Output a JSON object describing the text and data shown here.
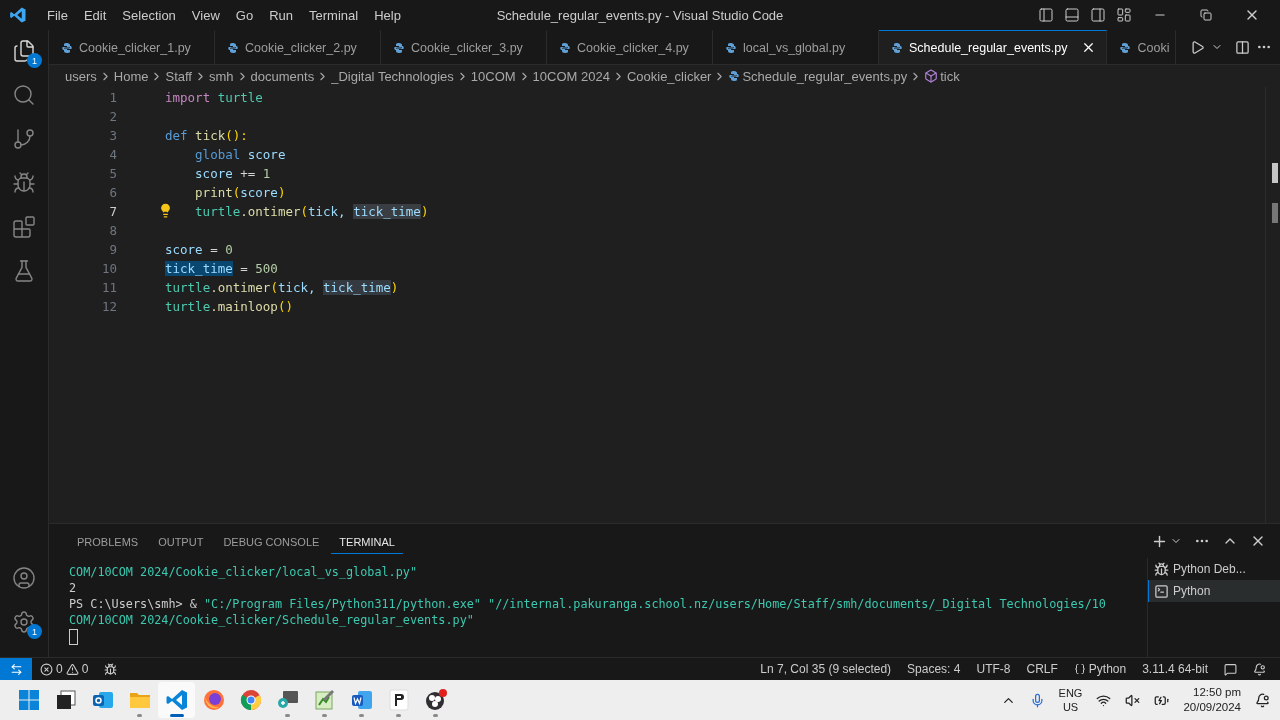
{
  "window": {
    "title": "Schedule_regular_events.py - Visual Studio Code"
  },
  "menu": [
    "File",
    "Edit",
    "Selection",
    "View",
    "Go",
    "Run",
    "Terminal",
    "Help"
  ],
  "activity_bar": [
    {
      "kind": "explorer",
      "badge": "1"
    },
    {
      "kind": "search"
    },
    {
      "kind": "source-control"
    },
    {
      "kind": "debug"
    },
    {
      "kind": "extensions"
    },
    {
      "kind": "testing"
    }
  ],
  "activity_bar_bottom": [
    {
      "kind": "account"
    },
    {
      "kind": "settings",
      "badge": "1"
    }
  ],
  "tabs": [
    {
      "label": "Cookie_clicker_1.py",
      "selected": false
    },
    {
      "label": "Cookie_clicker_2.py",
      "selected": false
    },
    {
      "label": "Cookie_clicker_3.py",
      "selected": false
    },
    {
      "label": "Cookie_clicker_4.py",
      "selected": false
    },
    {
      "label": "local_vs_global.py",
      "selected": false
    },
    {
      "label": "Schedule_regular_events.py",
      "selected": true
    },
    {
      "label": "Cooki",
      "selected": false
    }
  ],
  "breadcrumbs": [
    {
      "label": "users",
      "kind": "folder"
    },
    {
      "label": "Home",
      "kind": "folder"
    },
    {
      "label": "Staff",
      "kind": "folder"
    },
    {
      "label": "smh",
      "kind": "folder"
    },
    {
      "label": "documents",
      "kind": "folder"
    },
    {
      "label": "_Digital Technologies",
      "kind": "folder"
    },
    {
      "label": "10COM",
      "kind": "folder"
    },
    {
      "label": "10COM 2024",
      "kind": "folder"
    },
    {
      "label": "Cookie_clicker",
      "kind": "folder"
    },
    {
      "label": "Schedule_regular_events.py",
      "kind": "file"
    },
    {
      "label": "tick",
      "kind": "symbol"
    }
  ],
  "editor": {
    "lines": [
      {
        "number": "1",
        "current": false,
        "tokens": [
          {
            "text": "import",
            "kind": "keyword"
          },
          {
            "text": " turtle",
            "kind": "module"
          }
        ]
      },
      {
        "number": "2",
        "current": false
      },
      {
        "number": "3",
        "current": false,
        "tokens": [
          {
            "text": "def",
            "kind": "storage"
          },
          {
            "text": " tick",
            "kind": "function"
          },
          {
            "text": "():",
            "kind": "bracket"
          }
        ]
      },
      {
        "number": "4",
        "current": false,
        "indent": true,
        "tokens": [
          {
            "text": "global",
            "kind": "storage"
          },
          {
            "text": " score",
            "kind": "variable"
          }
        ]
      },
      {
        "number": "5",
        "current": false,
        "indent": true,
        "tokens": [
          {
            "text": "score",
            "kind": "variable"
          },
          {
            "text": " += ",
            "kind": "operator"
          },
          {
            "text": "1",
            "kind": "number"
          }
        ]
      },
      {
        "number": "6",
        "current": false,
        "indent": true,
        "tokens": [
          {
            "text": "print",
            "kind": "function"
          },
          {
            "text": "(",
            "kind": "bracket"
          },
          {
            "text": "score",
            "kind": "variable"
          },
          {
            "text": ")",
            "kind": "bracket"
          }
        ]
      },
      {
        "number": "7",
        "current": true,
        "indent": true,
        "lightbulb": true,
        "tokens": [
          {
            "text": "turtle",
            "kind": "module"
          },
          {
            "text": ".ontimer",
            "kind": "function"
          },
          {
            "text": "(",
            "kind": "bracket"
          },
          {
            "text": "tick, ",
            "kind": "variable"
          },
          {
            "text": "tick_time",
            "kind": "variable",
            "selected": true
          },
          {
            "text": ")",
            "kind": "bracket"
          }
        ]
      },
      {
        "number": "8",
        "current": false
      },
      {
        "number": "9",
        "current": false,
        "tokens": [
          {
            "text": "score",
            "kind": "variable"
          },
          {
            "text": " = ",
            "kind": "operator"
          },
          {
            "text": "0",
            "kind": "number"
          }
        ]
      },
      {
        "number": "10",
        "current": false,
        "tokens": [
          {
            "text": "tick_time",
            "kind": "variable",
            "highlighted": true,
            "write": true
          },
          {
            "text": " = ",
            "kind": "operator"
          },
          {
            "text": "500",
            "kind": "number"
          }
        ]
      },
      {
        "number": "11",
        "current": false,
        "tokens": [
          {
            "text": "turtle",
            "kind": "module"
          },
          {
            "text": ".ontimer",
            "kind": "function"
          },
          {
            "text": "(",
            "kind": "bracket"
          },
          {
            "text": "tick, ",
            "kind": "variable"
          },
          {
            "text": "tick_time",
            "kind": "variable",
            "highlighted": true
          },
          {
            "text": ")",
            "kind": "bracket"
          }
        ]
      },
      {
        "number": "12",
        "current": false,
        "tokens": [
          {
            "text": "turtle",
            "kind": "module"
          },
          {
            "text": ".mainloop",
            "kind": "function"
          },
          {
            "text": "()",
            "kind": "bracket"
          }
        ]
      }
    ]
  },
  "panel": {
    "tabs": [
      {
        "label": "PROBLEMS",
        "selected": false
      },
      {
        "label": "OUTPUT",
        "selected": false
      },
      {
        "label": "DEBUG CONSOLE",
        "selected": false
      },
      {
        "label": "TERMINAL",
        "selected": true
      }
    ],
    "terminal_lines": [
      [
        {
          "text": "COM/10COM 2024/Cookie_clicker/local_vs_global.py\"",
          "kind": "string"
        }
      ],
      [
        {
          "text": "2",
          "kind": "output"
        }
      ],
      [
        {
          "text": "PS C:\\Users\\smh> & ",
          "kind": "output"
        },
        {
          "text": "\"C:/Program Files/Python311/python.exe\" \"//internal.pakuranga.school.nz/users/Home/Staff/smh/documents/_Digital Technologies/10",
          "kind": "string"
        }
      ],
      [
        {
          "text": "COM/10COM 2024/Cookie_clicker/Schedule_regular_events.py\"",
          "kind": "string"
        }
      ]
    ],
    "terminals": [
      {
        "label": "Python Deb...",
        "kind": "debug",
        "selected": false
      },
      {
        "label": "Python",
        "kind": "shell",
        "selected": true
      }
    ]
  },
  "status_bar": {
    "errors": "0",
    "warnings": "0",
    "right": [
      "Ln 7, Col 35 (9 selected)",
      "Spaces: 4",
      "UTF-8",
      "CRLF",
      "Python",
      "3.11.4 64-bit"
    ]
  },
  "taskbar": {
    "apps": [
      {
        "kind": "start",
        "running": false,
        "active": false
      },
      {
        "kind": "task-view",
        "running": false,
        "active": false
      },
      {
        "kind": "mail",
        "running": false,
        "active": false
      },
      {
        "kind": "folder",
        "running": true,
        "active": false
      },
      {
        "kind": "code",
        "running": true,
        "active": true
      },
      {
        "kind": "fox",
        "running": false,
        "active": false
      },
      {
        "kind": "wheel",
        "running": false,
        "active": false
      },
      {
        "kind": "remote",
        "running": true,
        "active": false
      },
      {
        "kind": "notepad",
        "running": true,
        "active": false
      },
      {
        "kind": "word",
        "running": true,
        "active": false
      },
      {
        "kind": "pdf",
        "running": true,
        "active": false
      },
      {
        "kind": "record",
        "running": true,
        "active": false
      }
    ],
    "language": "ENG",
    "region": "US",
    "time": "12:50 pm",
    "date": "20/09/2024"
  }
}
